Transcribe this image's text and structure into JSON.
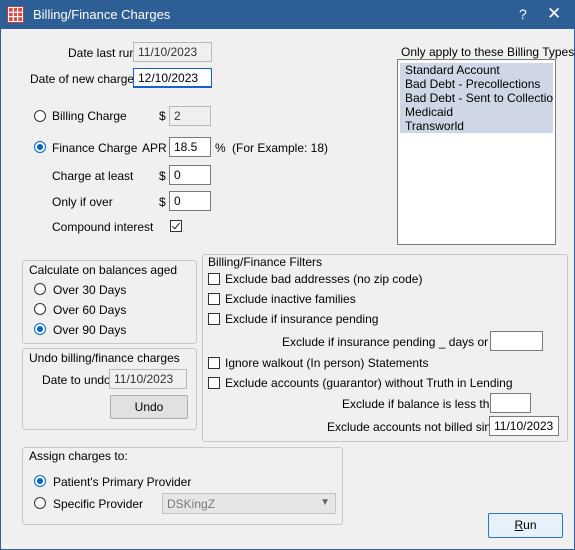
{
  "window": {
    "title": "Billing/Finance Charges",
    "help": "?",
    "close": "✕"
  },
  "dates": {
    "date_last_run_label": "Date last run",
    "date_last_run": "11/10/2023",
    "date_new_charges_label": "Date of new charges",
    "date_new_charges": "12/10/2023"
  },
  "charge_type": {
    "billing_label": "Billing Charge",
    "billing_currency": "$",
    "billing_amount": "2",
    "billing_selected": false,
    "finance_label": "Finance Charge",
    "apr_label": "APR",
    "apr_value": "18.5",
    "percent": "%",
    "example": "(For Example: 18)",
    "finance_selected": true,
    "charge_at_least_label": "Charge at least",
    "charge_at_least_currency": "$",
    "charge_at_least": "0",
    "only_if_over_label": "Only if over",
    "only_if_over_currency": "$",
    "only_if_over": "0",
    "compound_label": "Compound interest",
    "compound_checked": true
  },
  "billing_types": {
    "label": "Only apply to these Billing Types",
    "items": [
      "Standard Account",
      "Bad Debt - Precollections",
      "Bad Debt - Sent to Collections",
      "Medicaid",
      "Transworld"
    ]
  },
  "aged": {
    "title": "Calculate on balances aged",
    "options": [
      "Over 30 Days",
      "Over 60 Days",
      "Over 90 Days"
    ],
    "selected": "Over 90 Days"
  },
  "undo": {
    "title": "Undo billing/finance charges",
    "date_label": "Date to undo",
    "date_value": "11/10/2023",
    "button": "Undo"
  },
  "filters": {
    "title": "Billing/Finance Filters",
    "exclude_bad_addresses": "Exclude bad addresses (no zip code)",
    "exclude_inactive": "Exclude inactive families",
    "exclude_ins_pending": "Exclude if insurance pending",
    "exclude_ins_days_label": "Exclude if insurance pending _ days or less",
    "exclude_ins_days_value": "",
    "ignore_walkout": "Ignore walkout (In person) Statements",
    "exclude_no_til": "Exclude accounts (guarantor) without Truth in Lending",
    "exclude_balance_label": "Exclude if balance is less than",
    "exclude_balance_value": "",
    "exclude_not_billed_label": "Exclude accounts not billed since",
    "exclude_not_billed_value": "11/10/2023"
  },
  "assign": {
    "title": "Assign charges to:",
    "primary_label": "Patient's Primary Provider",
    "primary_selected": true,
    "specific_label": "Specific Provider",
    "specific_selected": false,
    "provider_value": "DSKingZ"
  },
  "run_button": {
    "first": "R",
    "rest": "un"
  },
  "accent_color": "#0067c0",
  "titlebar_color": "#2e5e96"
}
